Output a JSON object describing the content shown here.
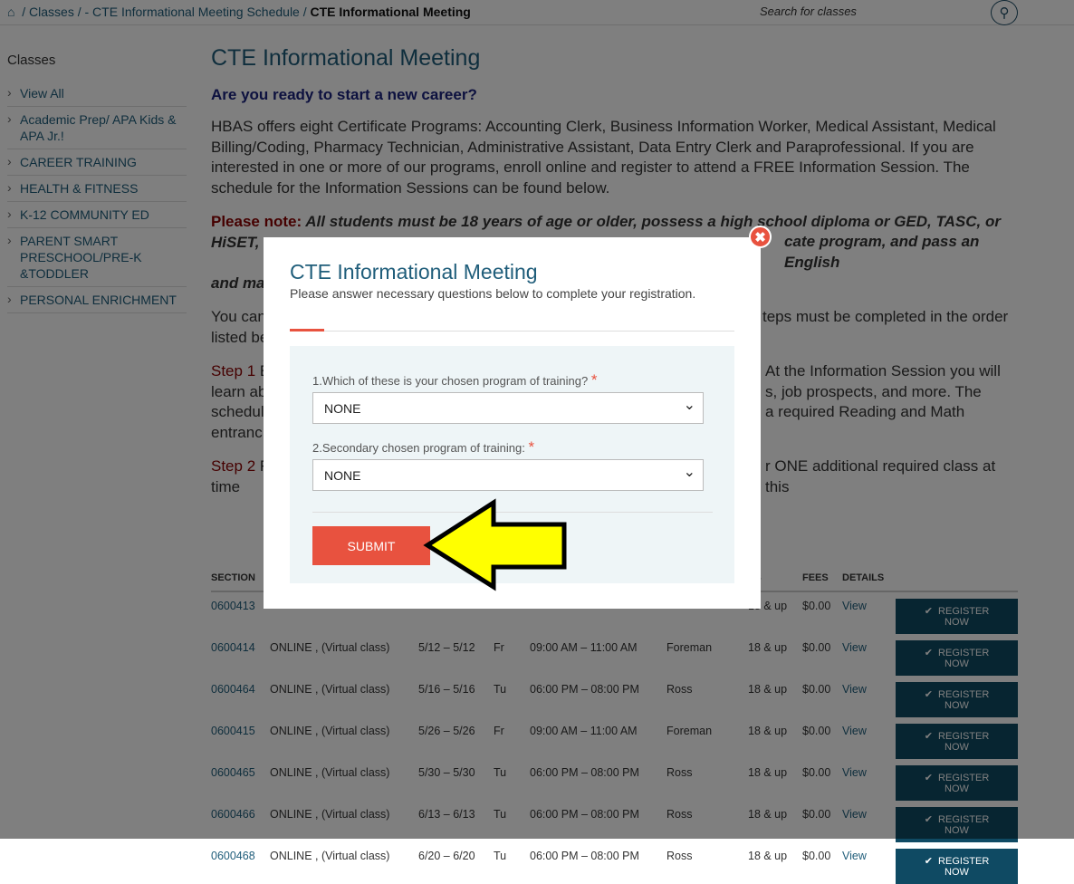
{
  "breadcrumb": {
    "home_icon": "home-icon",
    "items": [
      "/ Classes /",
      "- CTE Informational Meeting Schedule /"
    ],
    "current": "CTE Informational Meeting"
  },
  "search": {
    "placeholder": "Search for classes",
    "icon": "search-icon"
  },
  "sidebar": {
    "title": "Classes",
    "items": [
      "View All",
      "Academic Prep/ APA Kids & APA Jr.!",
      "CAREER TRAINING",
      "HEALTH & FITNESS",
      "K-12 COMMUNITY ED",
      "PARENT SMART PRESCHOOL/PRE-K &TODDLER",
      "PERSONAL ENRICHMENT"
    ]
  },
  "main": {
    "title": "CTE Informational Meeting",
    "subtitle": "Are you ready to start a new career?",
    "intro": " HBAS offers eight Certificate Programs: Accounting Clerk, Business Information Worker, Medical Assistant, Medical Billing/Coding, Pharmacy Technician, Administrative Assistant, Data Entry Clerk and Paraprofessional. If you are interested in one or more of our programs, enroll online and register to attend a FREE Information Session. The schedule for the Information Sessions can be found below.",
    "note_label": "Please note:",
    "note": " All students must be 18 years of age or older, possess a high school diploma or GED, TASC, or HiSET, must at",
    "note2": "cate program, and pass an English",
    "note3": "and ma",
    "p_you": "You can",
    "p_you_r": "teps must be completed in the order",
    "p_listed": "listed be",
    "step1": "Step 1",
    "step1_a": " E",
    "step1_r": "At the Information Session you will",
    "step1_b": "learn ab",
    "step1_br": "s, job prospects, and more. The",
    "step1_c": "schedul",
    "step1_cr": "a required Reading and Math",
    "step1_d": "entranc",
    "step2": "Step 2",
    "step2_a": " R",
    "step2_r": "r ONE additional required class at this",
    "step2_b": "time"
  },
  "table": {
    "headers": [
      "SECTION",
      "",
      "",
      "",
      "",
      "",
      "ES",
      "FEES",
      "DETAILS",
      ""
    ],
    "register_label": "REGISTER NOW",
    "check_icon": "check-icon",
    "rows": [
      [
        "0600413",
        "",
        "",
        "",
        "",
        "",
        "18 & up",
        "$0.00",
        "View"
      ],
      [
        "0600414",
        "ONLINE , (Virtual class)",
        "5/12 – 5/12",
        "Fr",
        "09:00 AM – 11:00 AM",
        "Foreman",
        "18 & up",
        "$0.00",
        "View"
      ],
      [
        "0600464",
        "ONLINE , (Virtual class)",
        "5/16 – 5/16",
        "Tu",
        "06:00 PM – 08:00 PM",
        "Ross",
        "18 & up",
        "$0.00",
        "View"
      ],
      [
        "0600415",
        "ONLINE , (Virtual class)",
        "5/26 – 5/26",
        "Fr",
        "09:00 AM – 11:00 AM",
        "Foreman",
        "18 & up",
        "$0.00",
        "View"
      ],
      [
        "0600465",
        "ONLINE , (Virtual class)",
        "5/30 – 5/30",
        "Tu",
        "06:00 PM – 08:00 PM",
        "Ross",
        "18 & up",
        "$0.00",
        "View"
      ],
      [
        "0600466",
        "ONLINE , (Virtual class)",
        "6/13 – 6/13",
        "Tu",
        "06:00 PM – 08:00 PM",
        "Ross",
        "18 & up",
        "$0.00",
        "View"
      ],
      [
        "0600468",
        "ONLINE , (Virtual class)",
        "6/20 – 6/20",
        "Tu",
        "06:00 PM – 08:00 PM",
        "Ross",
        "18 & up",
        "$0.00",
        "View"
      ]
    ]
  },
  "modal": {
    "title": "CTE Informational Meeting",
    "subtitle": "Please answer necessary questions below to complete your registration.",
    "q1": "1.Which of these is your chosen program of training?",
    "q1_value": "NONE",
    "q2": "2.Secondary chosen program of training:",
    "q2_value": "NONE",
    "required": "*",
    "submit": "SUBMIT",
    "close_icon": "close-icon"
  },
  "annotation": {
    "arrow_icon": "yellow-arrow-left-icon",
    "color": "#ffff00"
  },
  "colors": {
    "accent": "#e8523f",
    "primary": "#1f5d7a",
    "button": "#0f4a63"
  }
}
